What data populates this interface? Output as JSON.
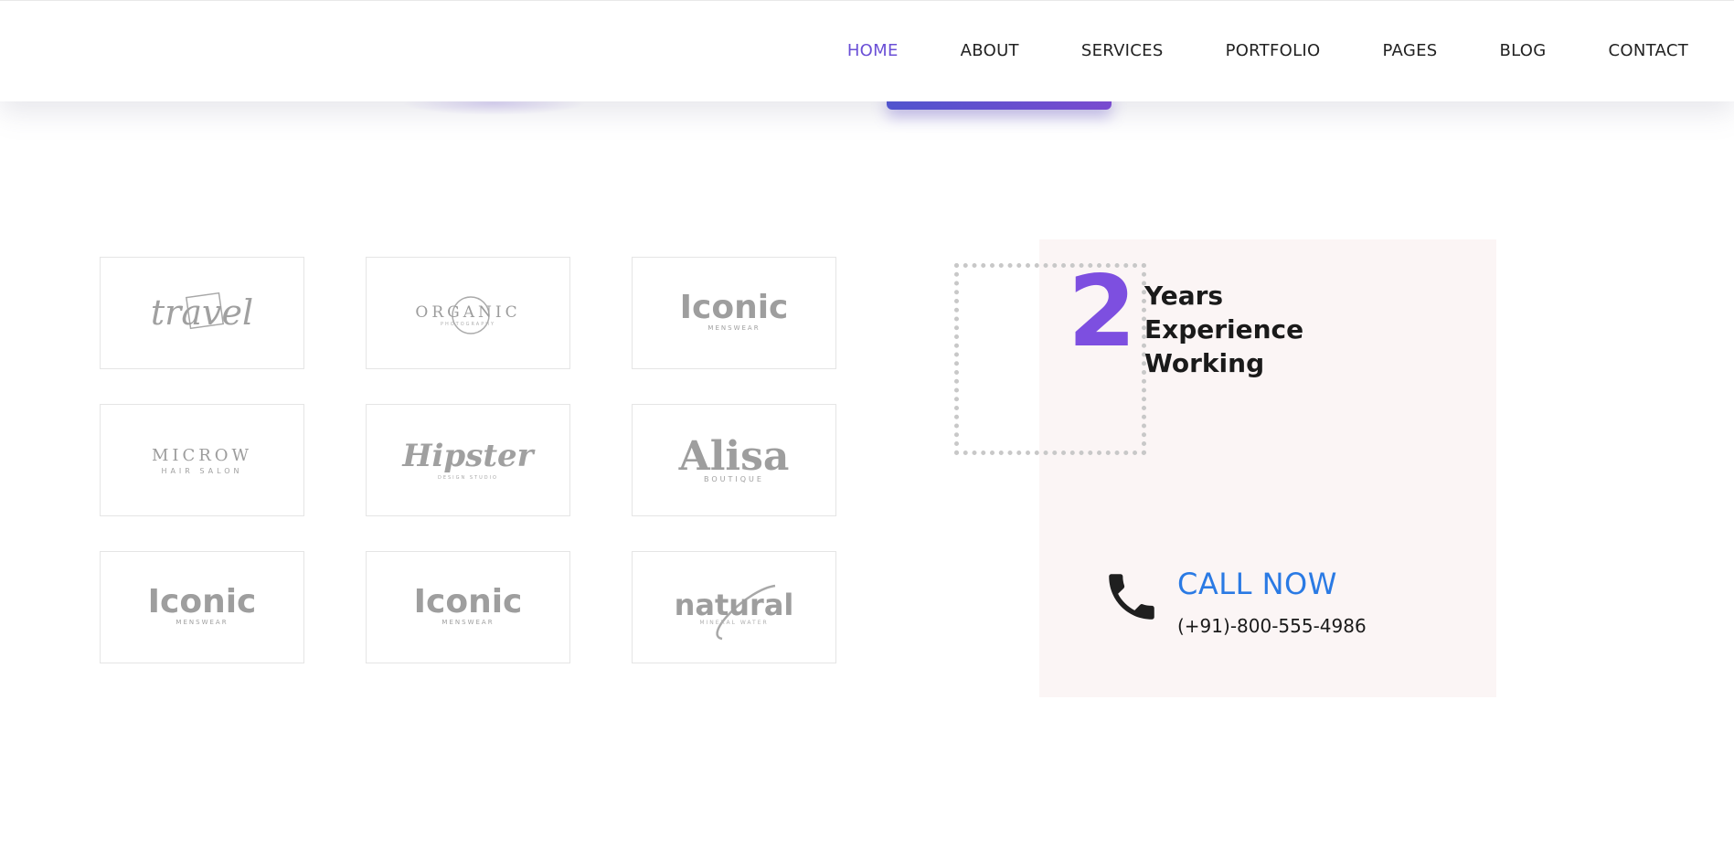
{
  "nav": {
    "items": [
      "HOME",
      "ABOUT",
      "SERVICES",
      "PORTFOLIO",
      "PAGES",
      "BLOG",
      "CONTACT"
    ],
    "active": "HOME"
  },
  "logos": [
    {
      "name": "travel",
      "text": "travel"
    },
    {
      "name": "organic",
      "text": "ORGANIC",
      "sub": "PHOTOGRAPHY"
    },
    {
      "name": "iconic",
      "text": "Iconic",
      "sub": "MENSWEAR"
    },
    {
      "name": "microw",
      "text": "MICROW",
      "sub": "HAIR SALON"
    },
    {
      "name": "hipster",
      "text": "Hipster",
      "sub": "DESIGN STUDIO"
    },
    {
      "name": "alisa",
      "text": "Alisa",
      "sub": "BOUTIQUE"
    },
    {
      "name": "iconic-2",
      "text": "Iconic",
      "sub": "MENSWEAR"
    },
    {
      "name": "iconic-3",
      "text": "Iconic",
      "sub": "MENSWEAR"
    },
    {
      "name": "natural",
      "text": "natural",
      "sub": "MINERAL WATER"
    }
  ],
  "experience": {
    "years": "2",
    "line1": "Years",
    "line2": "Experience",
    "line3": "Working"
  },
  "call": {
    "title": "CALL NOW",
    "number": "(+91)-800-555-4986"
  },
  "colors": {
    "accent": "#7d4fe0",
    "nav_active": "#6a4fd6",
    "call_blue": "#2a7ae4",
    "panel_bg": "#fbf5f5"
  },
  "icons": {
    "phone": "phone-icon"
  }
}
